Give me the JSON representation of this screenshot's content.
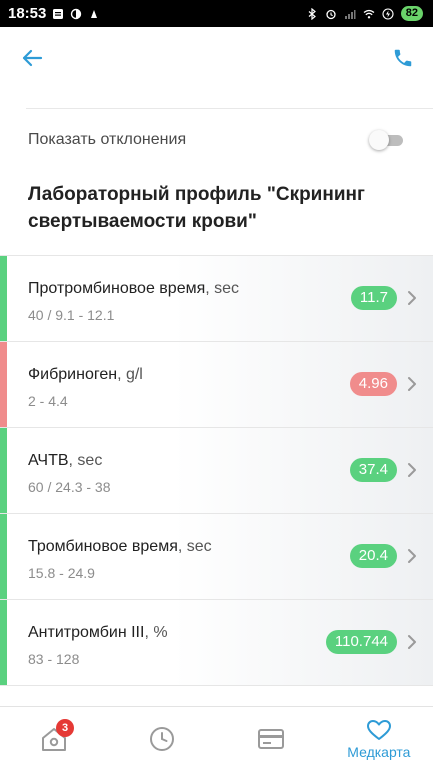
{
  "statusbar": {
    "time": "18:53",
    "battery": "82"
  },
  "appbar": {
    "back_icon": "arrow-left-icon",
    "call_icon": "phone-icon"
  },
  "filters": {
    "show_deviations_label": "Показать отклонения",
    "show_deviations_on": false
  },
  "section": {
    "title": "Лабораторный профиль \"Скрининг свертываемости крови\""
  },
  "colors": {
    "normal": "#5ad17f",
    "abnormal": "#f08c8c",
    "accent": "#2e9bd6"
  },
  "tests": [
    {
      "name": "Протромбиновое время",
      "unit": ", sec",
      "range": "40 / 9.1 - 12.1",
      "value": "11.7",
      "status": "normal"
    },
    {
      "name": "Фибриноген",
      "unit": ", g/l",
      "range": "2 - 4.4",
      "value": "4.96",
      "status": "abnormal"
    },
    {
      "name": "АЧТВ",
      "unit": ", sec",
      "range": "60 / 24.3 - 38",
      "value": "37.4",
      "status": "normal"
    },
    {
      "name": "Тромбиновое время",
      "unit": ", sec",
      "range": "15.8 - 24.9",
      "value": "20.4",
      "status": "normal"
    },
    {
      "name": "Антитромбин III",
      "unit": ", %",
      "range": "83 - 128",
      "value": "110.744",
      "status": "normal"
    }
  ],
  "bottomnav": {
    "home_badge": "3",
    "medcard_label": "Медкарта"
  }
}
